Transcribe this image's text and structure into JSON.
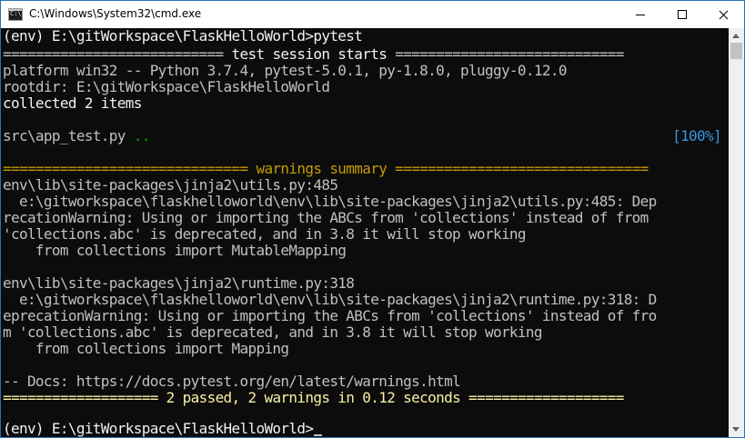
{
  "window": {
    "title": "C:\\Windows\\System32\\cmd.exe",
    "icon": "cmd-icon",
    "icon_text": "C:\\"
  },
  "console": {
    "line1": "(env) E:\\gitWorkspace\\FlaskHelloWorld>pytest",
    "sep1_left": "=========================== ",
    "sep1_text": "test session starts",
    "sep1_right": " ============================",
    "line3": "platform win32 -- Python 3.7.4, pytest-5.0.1, py-1.8.0, pluggy-0.12.0",
    "line4": "rootdir: E:\\gitWorkspace\\FlaskHelloWorld",
    "line5": "collected 2 items",
    "test_file": "src\\app_test.py",
    "test_dots": " ..",
    "test_progress": "[100%]",
    "sep2_left": "============================== ",
    "sep2_text": "warnings summary",
    "sep2_right": " ===============================",
    "warn1_file": "env\\lib\\site-packages\\jinja2\\utils.py:485",
    "warn1_l1": "  e:\\gitworkspace\\flaskhelloworld\\env\\lib\\site-packages\\jinja2\\utils.py:485: Dep",
    "warn1_l2": "recationWarning: Using or importing the ABCs from 'collections' instead of from",
    "warn1_l3": "'collections.abc' is deprecated, and in 3.8 it will stop working",
    "warn1_l4": "    from collections import MutableMapping",
    "warn2_file": "env\\lib\\site-packages\\jinja2\\runtime.py:318",
    "warn2_l1": "  e:\\gitworkspace\\flaskhelloworld\\env\\lib\\site-packages\\jinja2\\runtime.py:318: D",
    "warn2_l2": "eprecationWarning: Using or importing the ABCs from 'collections' instead of fro",
    "warn2_l3": "m 'collections.abc' is deprecated, and in 3.8 it will stop working",
    "warn2_l4": "    from collections import Mapping",
    "docs": "-- Docs: https://docs.pytest.org/en/latest/warnings.html",
    "sep3_left": "=================== ",
    "sep3_text": "2 passed, 2 warnings in 0.12 seconds",
    "sep3_right": " ===================",
    "prompt": "(env) E:\\gitWorkspace\\FlaskHelloWorld>"
  },
  "colors": {
    "background": "#0c0c0c",
    "text": "#c0c0c0",
    "yellow": "#c19c00",
    "green": "#13a10e",
    "cyan": "#3a96dd"
  }
}
